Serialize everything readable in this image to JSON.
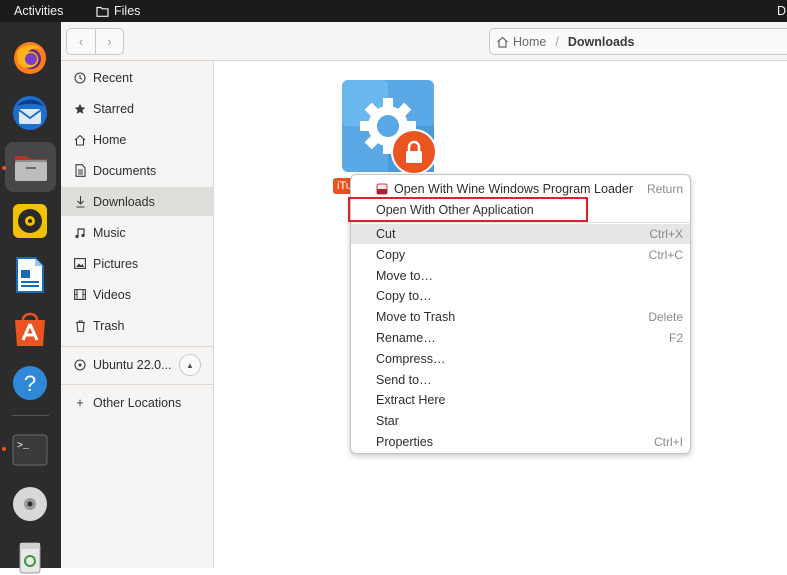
{
  "topbar": {
    "activities": "Activities",
    "app_name": "Files",
    "corner_text": "D"
  },
  "headerbar": {
    "back_glyph": "‹",
    "forward_glyph": "›",
    "path": {
      "home": "Home",
      "separator": "/",
      "current": "Downloads"
    }
  },
  "dock": {
    "items": [
      {
        "name": "firefox-icon"
      },
      {
        "name": "thunderbird-icon"
      },
      {
        "name": "files-icon",
        "active": true
      },
      {
        "name": "rhythmbox-icon"
      },
      {
        "name": "libreoffice-writer-icon"
      },
      {
        "name": "ubuntu-software-icon"
      },
      {
        "name": "help-icon",
        "glyph": "?"
      },
      {
        "name": "terminal-icon",
        "glyph": ">_"
      },
      {
        "name": "disc-icon"
      },
      {
        "name": "trash-icon"
      }
    ]
  },
  "sidebar": {
    "items": [
      {
        "label": "Recent",
        "icon": "clock-icon"
      },
      {
        "label": "Starred",
        "icon": "star-icon"
      },
      {
        "label": "Home",
        "icon": "home-icon"
      },
      {
        "label": "Documents",
        "icon": "document-icon"
      },
      {
        "label": "Downloads",
        "icon": "download-icon",
        "selected": true
      },
      {
        "label": "Music",
        "icon": "music-icon"
      },
      {
        "label": "Pictures",
        "icon": "picture-icon"
      },
      {
        "label": "Videos",
        "icon": "video-icon"
      },
      {
        "label": "Trash",
        "icon": "trash-icon"
      }
    ],
    "volume": {
      "label": "Ubuntu 22.0...",
      "eject_glyph": "▲"
    },
    "other": {
      "label": "Other Locations",
      "glyph": "+"
    }
  },
  "file": {
    "label": "iTu"
  },
  "context_menu": {
    "items": [
      {
        "label": "Open With Wine Windows Program Loader",
        "accel": "Return",
        "icon": "wine-icon"
      },
      {
        "label": "Open With Other Application",
        "accel": "",
        "highlighted_box": true
      },
      {
        "label": "Cut",
        "accel": "Ctrl+X",
        "hover": true
      },
      {
        "label": "Copy",
        "accel": "Ctrl+C"
      },
      {
        "label": "Move to…",
        "accel": ""
      },
      {
        "label": "Copy to…",
        "accel": ""
      },
      {
        "label": "Move to Trash",
        "accel": "Delete"
      },
      {
        "label": "Rename…",
        "accel": "F2"
      },
      {
        "label": "Compress…",
        "accel": ""
      },
      {
        "label": "Send to…",
        "accel": ""
      },
      {
        "label": "Extract Here",
        "accel": ""
      },
      {
        "label": "Star",
        "accel": ""
      },
      {
        "label": "Properties",
        "accel": "Ctrl+I"
      }
    ]
  },
  "colors": {
    "accent": "#e95420",
    "highlight_box": "#e0212c",
    "dock_bg": "#2c2c2c",
    "topbar_bg": "#1b1b1b"
  }
}
